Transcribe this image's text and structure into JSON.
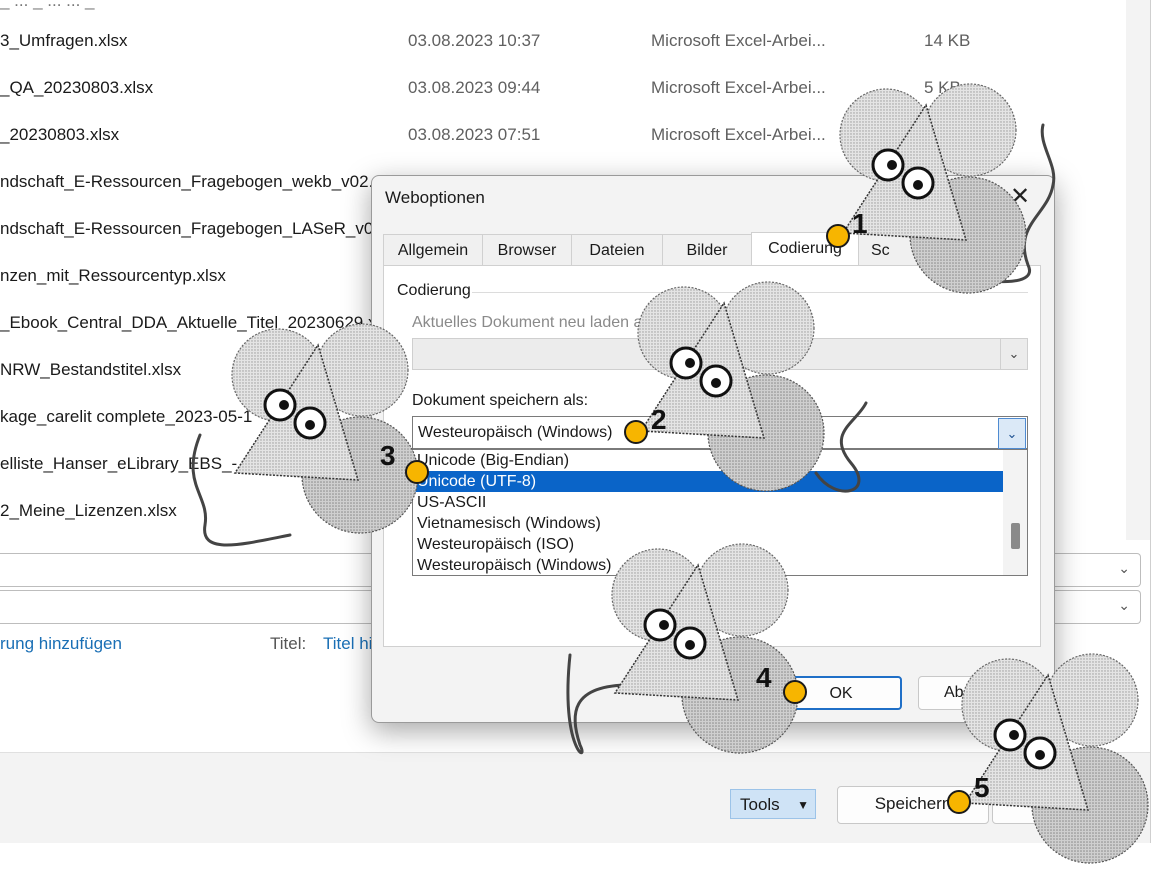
{
  "file_list": {
    "rows": [
      {
        "name": "3_Umfragen.xlsx",
        "date": "03.08.2023 10:37",
        "type": "Microsoft Excel-Arbei...",
        "size": "14 KB"
      },
      {
        "name": "_QA_20230803.xlsx",
        "date": "03.08.2023 09:44",
        "type": "Microsoft Excel-Arbei...",
        "size": "5 KB"
      },
      {
        "name": "_20230803.xlsx",
        "date": "03.08.2023 07:51",
        "type": "Microsoft Excel-Arbei...",
        "size": ""
      },
      {
        "name": "ndschaft_E-Ressourcen_Fragebogen_wekb_v02.x",
        "date": "",
        "type": "",
        "size": ""
      },
      {
        "name": "ndschaft_E-Ressourcen_Fragebogen_LASeR_v02.",
        "date": "",
        "type": "",
        "size": ""
      },
      {
        "name": "nzen_mit_Ressourcentyp.xlsx",
        "date": "",
        "type": "",
        "size": ""
      },
      {
        "name": "_Ebook_Central_DDA_Aktuelle_Titel_20230629.x",
        "date": "",
        "type": "",
        "size": ""
      },
      {
        "name": "NRW_Bestandstitel.xlsx",
        "date": "",
        "type": "",
        "size": ""
      },
      {
        "name": "kage_carelit complete_2023-05-1",
        "date": "",
        "type": "",
        "size": ""
      },
      {
        "name": "elliste_Hanser_eLibrary_EBS_-_",
        "date": "",
        "type": "",
        "size": ""
      },
      {
        "name": "2_Meine_Lizenzen.xlsx",
        "date": "",
        "type": "",
        "size": ""
      }
    ]
  },
  "file_dialog": {
    "tags_link": "rung hinzufügen",
    "title_label": "Titel:",
    "title_value": "Titel hi",
    "tools_label": "Tools",
    "save_label": "Speichern"
  },
  "web_dialog": {
    "title": "Weboptionen",
    "close_icon": "close-icon",
    "tabs": [
      {
        "label": "Allgemein"
      },
      {
        "label": "Browser"
      },
      {
        "label": "Dateien"
      },
      {
        "label": "Bilder"
      },
      {
        "label": "Codierung"
      },
      {
        "label": "Sc"
      }
    ],
    "active_tab": "Codierung",
    "group_label": "Codierung",
    "reload_label": "Aktuelles Dokument neu laden al",
    "saveas_label": "Dokument speichern als:",
    "saveas_value": "Westeuropäisch (Windows)",
    "encodings": [
      {
        "label": "Unicode (Big-Endian)",
        "selected": false
      },
      {
        "label": "Unicode (UTF-8)",
        "selected": true
      },
      {
        "label": "US-ASCII",
        "selected": false
      },
      {
        "label": "Vietnamesisch (Windows)",
        "selected": false
      },
      {
        "label": "Westeuropäisch (ISO)",
        "selected": false
      },
      {
        "label": "Westeuropäisch (Windows)",
        "selected": false
      }
    ],
    "ok_label": "OK",
    "cancel_label": "Ab"
  },
  "annotations": {
    "markers": [
      {
        "number": "1"
      },
      {
        "number": "2"
      },
      {
        "number": "3"
      },
      {
        "number": "4"
      },
      {
        "number": "5"
      }
    ],
    "marker_color": "#f7b500"
  },
  "colors": {
    "accent": "#0a64c8",
    "link": "#1a6fb5"
  }
}
